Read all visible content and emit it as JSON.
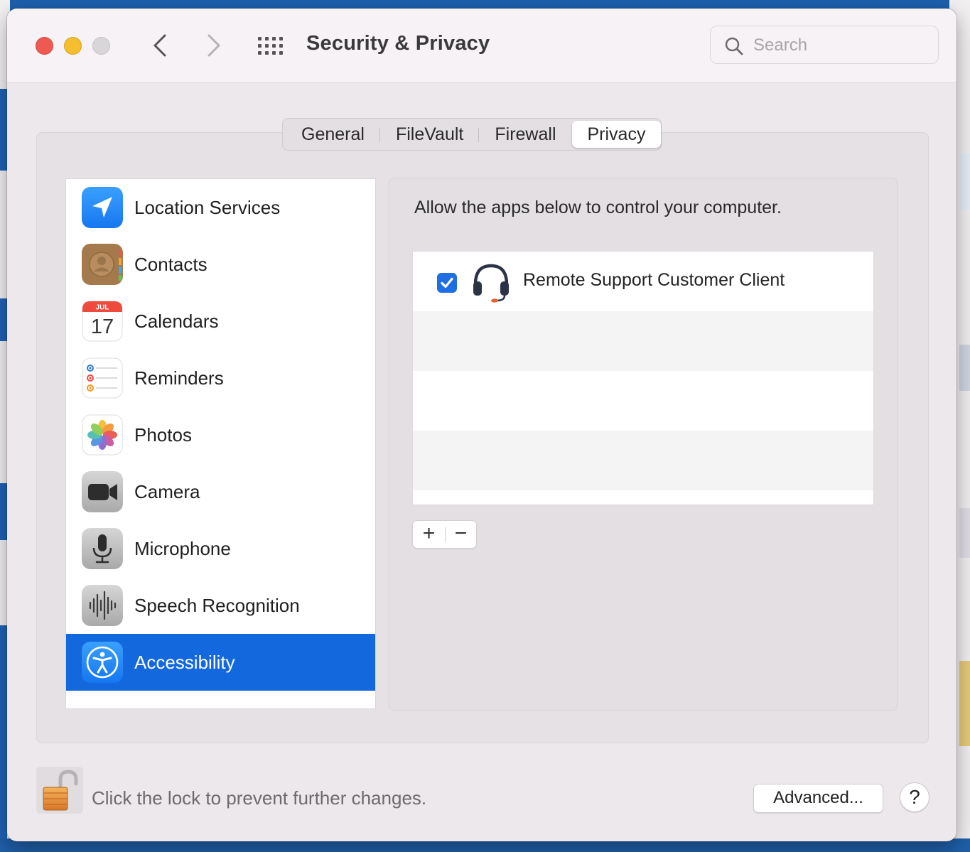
{
  "window": {
    "title": "Security & Privacy"
  },
  "search": {
    "placeholder": "Search"
  },
  "tabs": [
    {
      "label": "General",
      "active": false
    },
    {
      "label": "FileVault",
      "active": false
    },
    {
      "label": "Firewall",
      "active": false
    },
    {
      "label": "Privacy",
      "active": true
    }
  ],
  "sidebar": {
    "items": [
      {
        "label": "Location Services",
        "icon": "location-arrow-icon"
      },
      {
        "label": "Contacts",
        "icon": "contacts-icon"
      },
      {
        "label": "Calendars",
        "icon": "calendar-icon",
        "month": "JUL",
        "day": "17"
      },
      {
        "label": "Reminders",
        "icon": "reminders-icon"
      },
      {
        "label": "Photos",
        "icon": "photos-icon"
      },
      {
        "label": "Camera",
        "icon": "camera-icon"
      },
      {
        "label": "Microphone",
        "icon": "microphone-icon"
      },
      {
        "label": "Speech Recognition",
        "icon": "waveform-icon"
      },
      {
        "label": "Accessibility",
        "icon": "accessibility-icon",
        "selected": true
      }
    ]
  },
  "main": {
    "description": "Allow the apps below to control your computer.",
    "apps": [
      {
        "name": "Remote Support Customer Client",
        "checked": true,
        "icon": "headset-icon"
      }
    ],
    "add_label": "+",
    "remove_label": "−"
  },
  "footer": {
    "lock_text": "Click the lock to prevent further changes.",
    "advanced_label": "Advanced...",
    "help_label": "?"
  },
  "colors": {
    "selection": "#1368de",
    "checkbox": "#1f6fe3",
    "close": "#ee5a52",
    "minimize": "#f5be2f"
  }
}
